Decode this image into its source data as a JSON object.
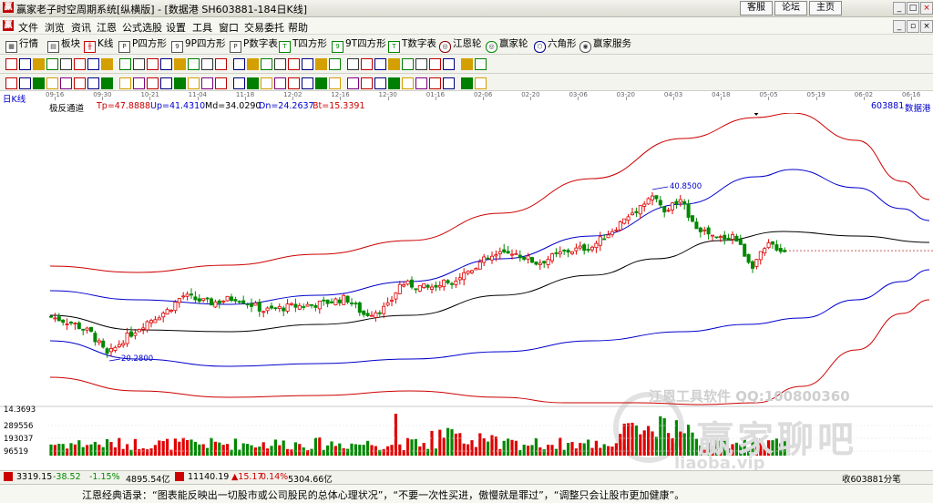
{
  "window": {
    "title": "赢家老子时空周期系统[纵横版] - [数据港  SH603881-184日K线]",
    "buttons": [
      "客服",
      "论坛",
      "主页"
    ],
    "controls": [
      "_",
      "□",
      "×"
    ]
  },
  "menu": [
    "文件",
    "浏览",
    "资讯",
    "江恩",
    "公式选股",
    "设置",
    "工具",
    "窗口",
    "交易委托",
    "帮助"
  ],
  "toolbar1": [
    "行情",
    "板块",
    "K线",
    "P四方形",
    "9P四方形",
    "P数字表",
    "T四方形",
    "9T四方形",
    "T数字表",
    "江恩轮",
    "赢家轮",
    "六角形",
    "赢家服务"
  ],
  "dates": [
    "09-16",
    "09-30",
    "10-21",
    "11-04",
    "11-18",
    "12-02",
    "12-16",
    "12-30",
    "01-16",
    "02-06",
    "02-20",
    "03-06",
    "03-20",
    "04-03",
    "04-18",
    "05-05",
    "05-19",
    "06-02",
    "06-16"
  ],
  "chart_title": "日K线",
  "indicator": {
    "name": "极反通道",
    "tp": "Tp=47.8888",
    "up": "Up=41.4310",
    "md": "Md=34.0290",
    "dn": "Dn=24.2637",
    "bt": "Bt=15.3391"
  },
  "stock": {
    "code": "603881",
    "name": "数据港"
  },
  "annotations": {
    "high": "40.8500",
    "low": "20.2800"
  },
  "volume_axis": [
    "14.3693",
    "289556",
    "193037",
    "96519"
  ],
  "status": {
    "sh": "3319.15",
    "sh_chg": "-38.52",
    "sh_pct": "-1.15%",
    "sh_amt": "4895.54亿",
    "sz": "11140.19",
    "sz_chg": "▲15.17",
    "sz_pct": "0.14%",
    "sz_amt": "5304.66亿",
    "right": "收603881分笔"
  },
  "watermark": {
    "line1": "江恩工具软件  QQ:100800360",
    "line2": "赢家聊吧",
    "line3": "liaoba.vip"
  },
  "footer": "江恩经典语录：“图表能反映出一切股市或公司股民的总体心理状况”，“不要一次性买进，傲慢就是罪过”，“调整只会让股市更加健康”。",
  "colors": {
    "up": "#e00000",
    "down": "#008800",
    "mid": "#000000",
    "inner": "#0000cc",
    "outer": "#cc0000"
  },
  "chart_data": {
    "type": "candlestick",
    "period": "daily",
    "high_marker": 40.85,
    "low_marker": 20.28,
    "channel_latest": {
      "Tp": 47.8888,
      "Up": 41.431,
      "Md": 34.029,
      "Dn": 24.2637,
      "Bt": 15.3391
    },
    "volume_ticks": [
      96519,
      193037,
      289556
    ]
  }
}
